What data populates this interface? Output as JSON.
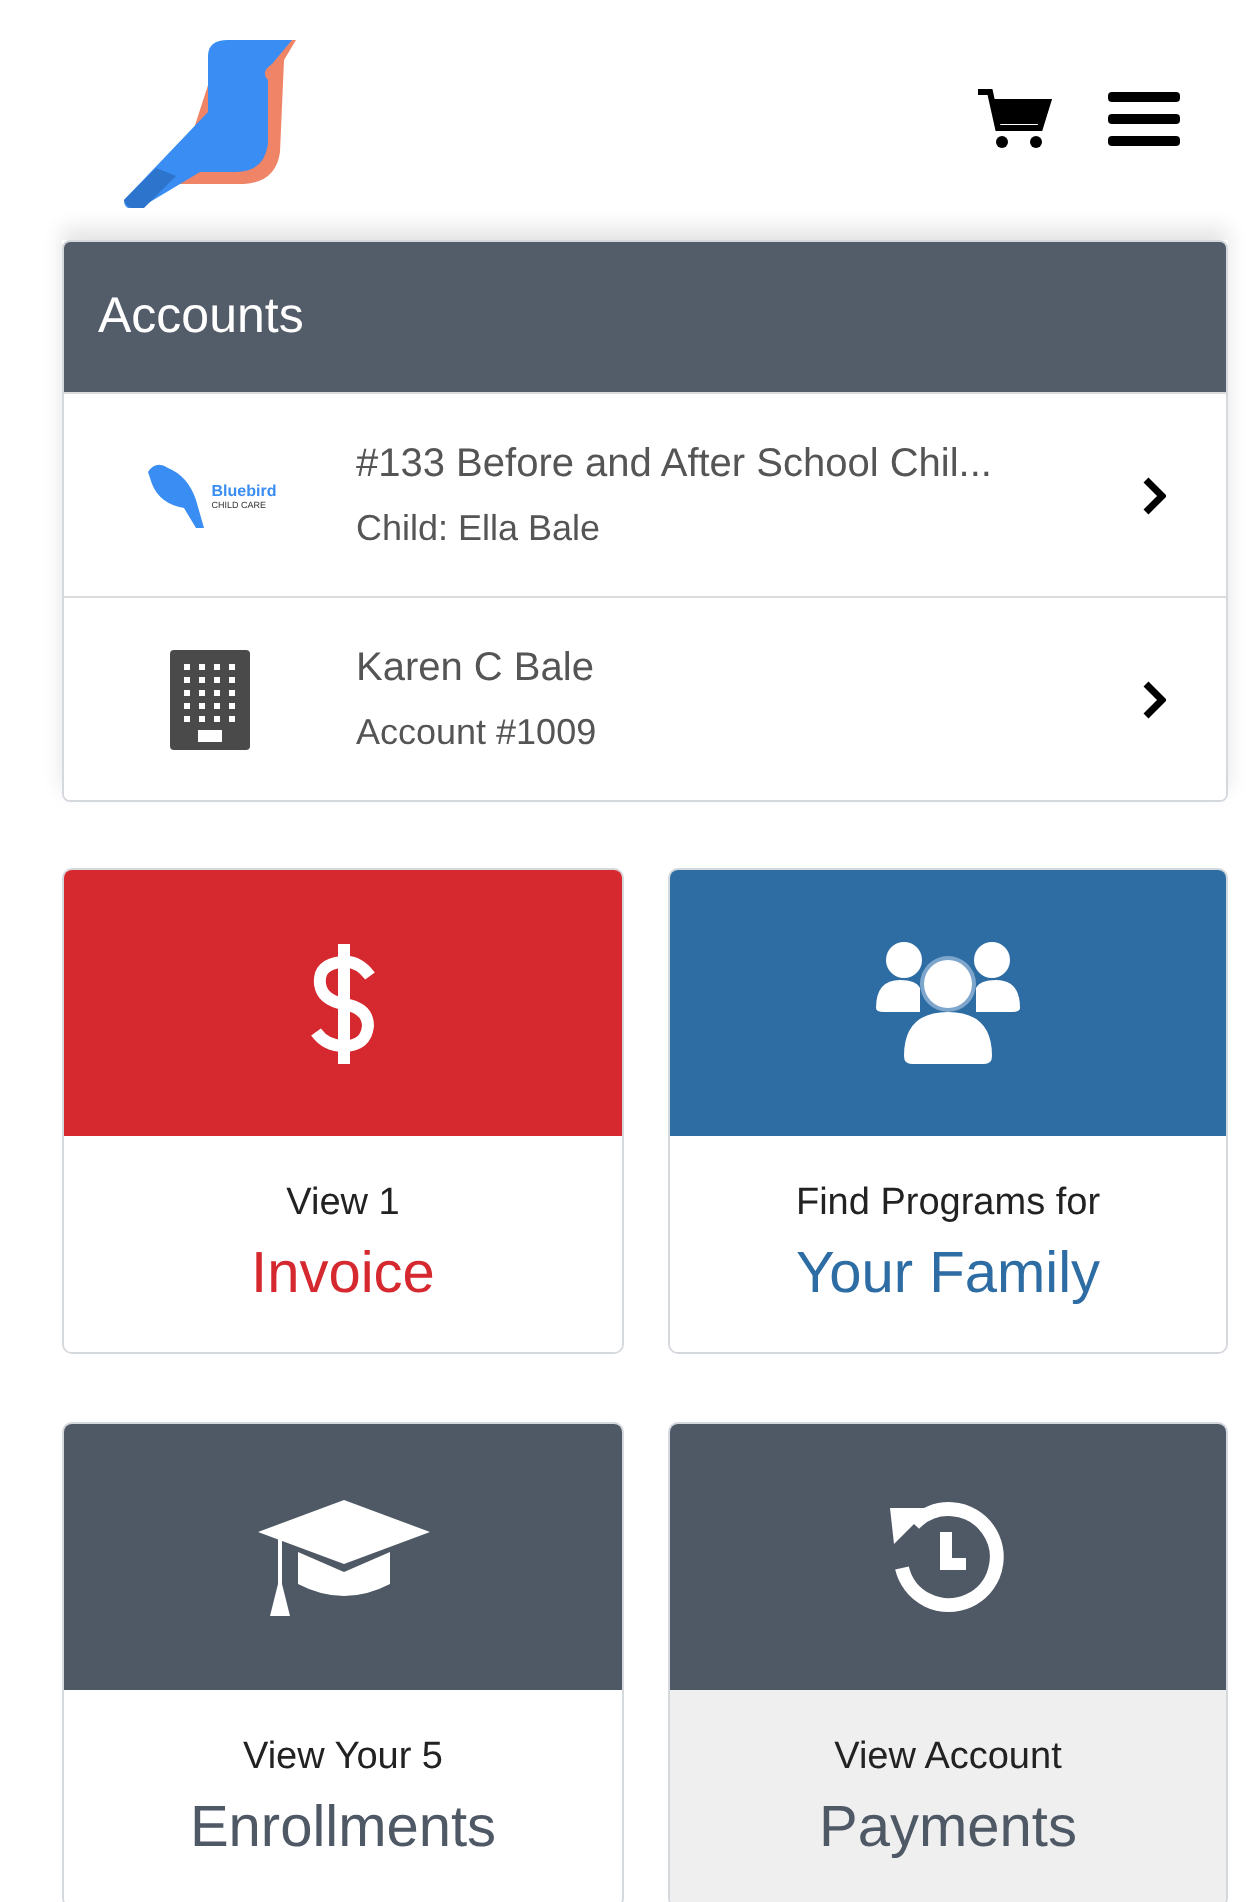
{
  "accounts": {
    "title": "Accounts",
    "items": [
      {
        "kind": "school",
        "logo_name": "Bluebird",
        "logo_tagline": "CHILD CARE",
        "title": "#133 Before and After School Chil...",
        "subtitle": "Child: Ella Bale"
      },
      {
        "kind": "building",
        "title": "Karen C Bale",
        "subtitle": "Account #1009"
      }
    ]
  },
  "tiles": [
    {
      "kind": "invoice",
      "color": "#d5282f",
      "line1": "View 1",
      "line2": "Invoice",
      "selected": false
    },
    {
      "kind": "programs",
      "color": "#2e6da4",
      "line1": "Find Programs for",
      "line2": "Your Family",
      "selected": false
    },
    {
      "kind": "enrollments",
      "color": "#4f5865",
      "line1": "View Your 5",
      "line2": "Enrollments",
      "selected": false
    },
    {
      "kind": "payments",
      "color": "#4f5865",
      "line1": "View Account",
      "line2": "Payments",
      "selected": true
    }
  ]
}
